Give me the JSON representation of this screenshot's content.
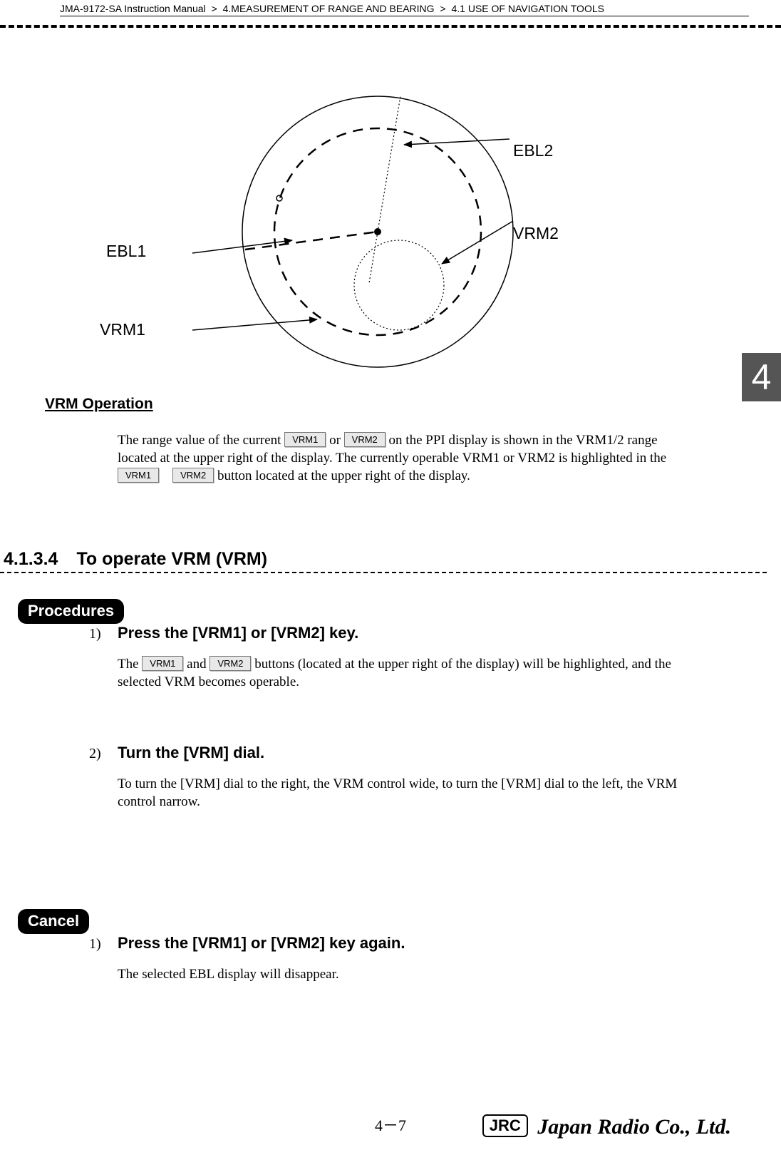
{
  "header": {
    "manual": "JMA-9172-SA Instruction Manual",
    "sep": ">",
    "chapter": "4.MEASUREMENT OF RANGE AND BEARING",
    "section": "4.1  USE OF NAVIGATION TOOLS"
  },
  "tab": "4",
  "diagram": {
    "labels": {
      "ebl1": "EBL1",
      "ebl2": "EBL2",
      "vrm1": "VRM1",
      "vrm2": "VRM2"
    }
  },
  "vrm_operation": {
    "title": "VRM Operation",
    "text_1": "The range value of the current ",
    "btn1": "VRM1",
    "text_2": " or ",
    "btn2": "VRM2",
    "text_3": " on the PPI display is shown in the VRM1/2 range located at the upper right of the display. The currently operable VRM1 or VRM2 is highlighted in the ",
    "btn3": "VRM1",
    "btn4": "VRM2",
    "text_4": " button located at the upper right of the display."
  },
  "section_4134": {
    "number": "4.1.3.4",
    "title": "To operate VRM (VRM)"
  },
  "procedures": {
    "label": "Procedures",
    "step1": {
      "num": "1)",
      "title": "Press the [VRM1] or [VRM2] key.",
      "text_1": "The ",
      "btn1": "VRM1",
      "text_2": " and ",
      "btn2": "VRM2",
      "text_3": " buttons (located at the upper right of the display) will be highlighted, and the selected VRM becomes operable."
    },
    "step2": {
      "num": "2)",
      "title": "Turn the [VRM] dial.",
      "text": "To turn the [VRM] dial to the right, the VRM control wide, to turn the [VRM] dial to the left, the VRM control narrow."
    }
  },
  "cancel": {
    "label": "Cancel",
    "step1": {
      "num": "1)",
      "title": "Press the [VRM1] or [VRM2] key again.",
      "text": "The selected EBL display will disappear."
    }
  },
  "footer": {
    "page": "4－7",
    "jrc": "JRC",
    "brand": "Japan Radio Co., Ltd."
  }
}
